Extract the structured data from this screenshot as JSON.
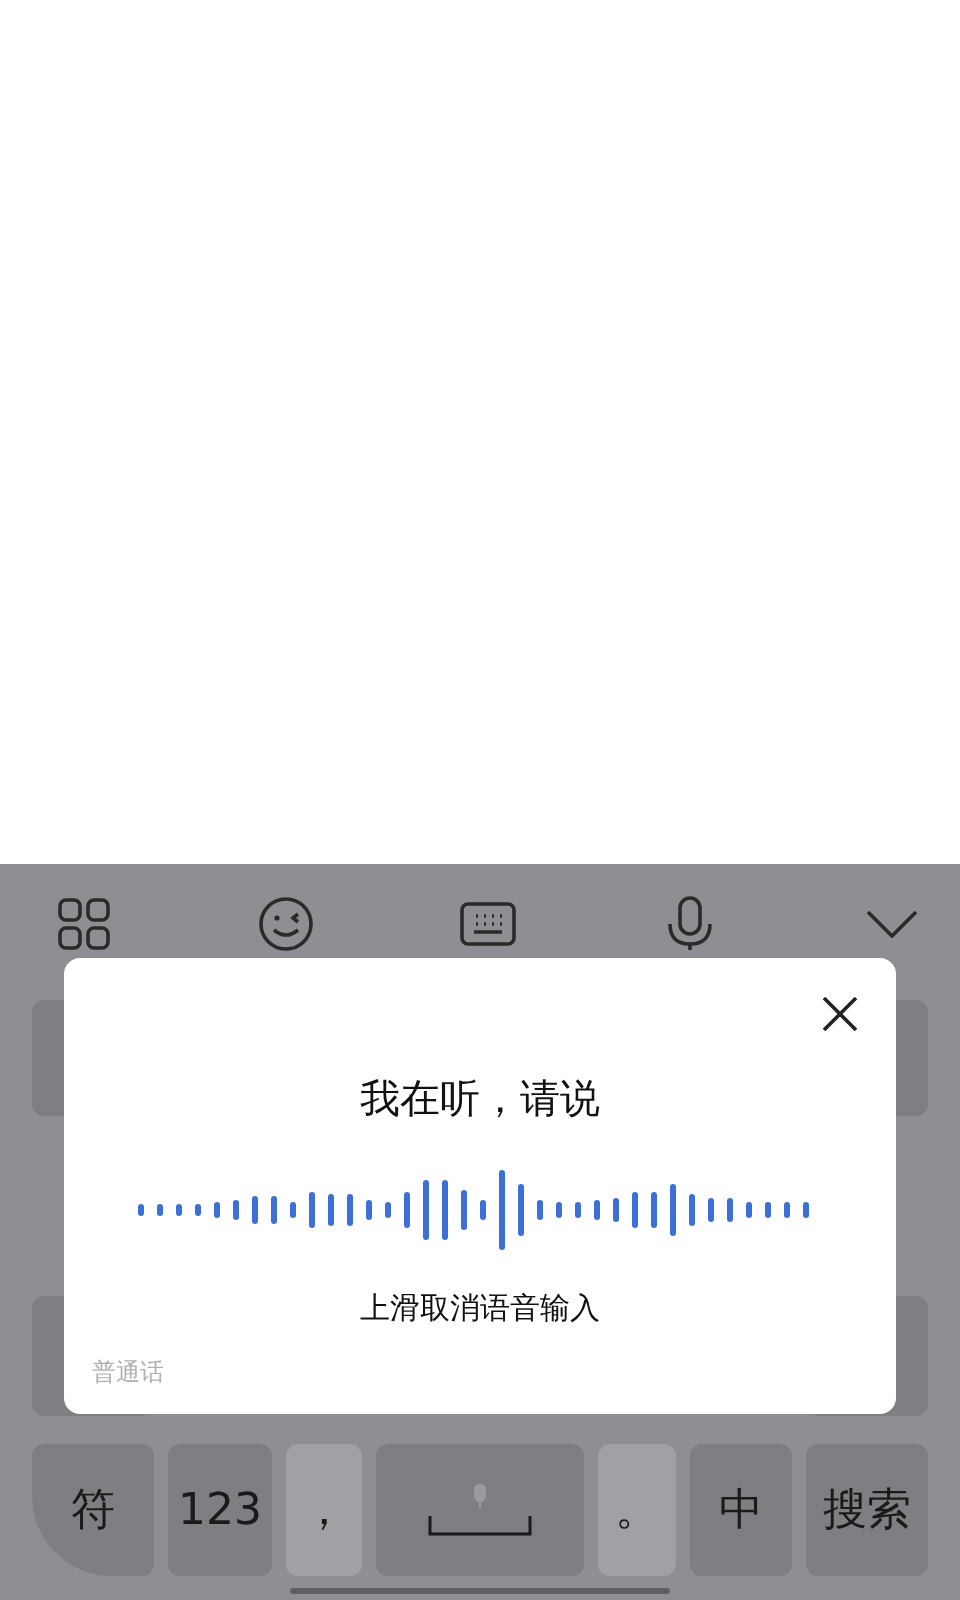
{
  "toolbar": {
    "items": [
      {
        "kind": "apps"
      },
      {
        "kind": "emoji"
      },
      {
        "kind": "keyboard"
      },
      {
        "kind": "voice"
      },
      {
        "kind": "collapse"
      }
    ]
  },
  "voice_dialog": {
    "title": "我在听，请说",
    "hint": "上滑取消语音输入",
    "language": "普通话"
  },
  "keyboard": {
    "bottom_row": [
      {
        "label": "符",
        "kind": "function"
      },
      {
        "label": "123",
        "kind": "function"
      },
      {
        "label": "，",
        "kind": "punct"
      },
      {
        "kind": "space"
      },
      {
        "label": "。",
        "kind": "punct"
      },
      {
        "label": "中",
        "kind": "function"
      },
      {
        "label": "搜索",
        "kind": "function"
      }
    ]
  }
}
